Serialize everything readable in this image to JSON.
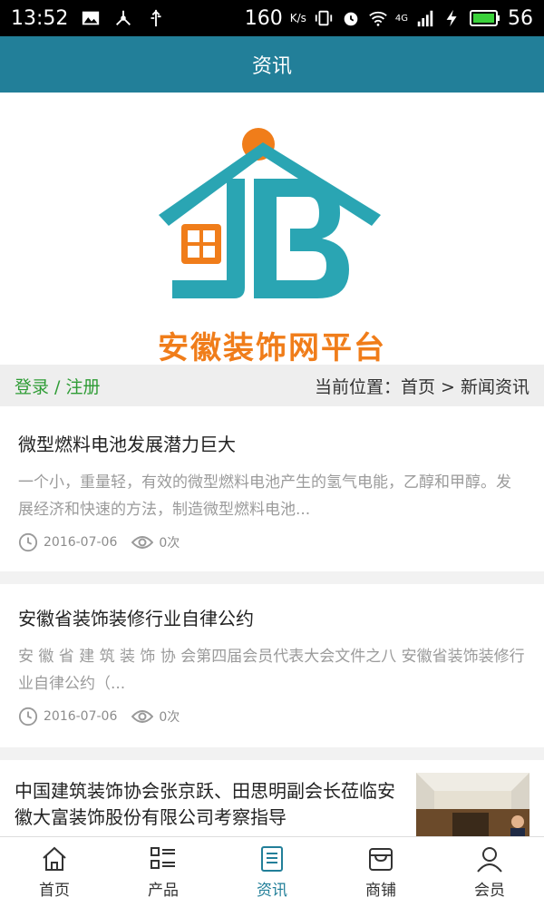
{
  "status": {
    "time": "13:52",
    "speed": "160",
    "speed_unit": "K/s",
    "network": "4G",
    "battery": "56"
  },
  "header": {
    "title": "资讯"
  },
  "logo": {
    "text": "安徽装饰网平台"
  },
  "crumb": {
    "login": "登录 / 注册",
    "location": "当前位置：首页 > 新闻资讯"
  },
  "news": [
    {
      "title": "微型燃料电池发展潜力巨大",
      "summary": "一个小，重量轻，有效的微型燃料电池产生的氢气电能，乙醇和甲醇。发展经济和快速的方法，制造微型燃料电池...",
      "date": "2016-07-06",
      "views": "0次"
    },
    {
      "title": "安徽省装饰装修行业自律公约",
      "summary": "安 徽 省 建 筑 装 饰 协 会第四届会员代表大会文件之八 安徽省装饰装修行业自律公约（...",
      "date": "2016-07-06",
      "views": "0次"
    },
    {
      "title": "中国建筑装饰协会张京跃、田思明副会长莅临安徽大富装饰股份有限公司考察指导"
    }
  ],
  "tabs": [
    {
      "label": "首页",
      "icon": "home-icon"
    },
    {
      "label": "产品",
      "icon": "grid-list-icon"
    },
    {
      "label": "资讯",
      "icon": "news-icon",
      "active": true
    },
    {
      "label": "商铺",
      "icon": "shop-icon"
    },
    {
      "label": "会员",
      "icon": "user-icon"
    }
  ],
  "colors": {
    "accent": "#227f99",
    "login_green": "#2e9c35",
    "logo_orange": "#f07d1a",
    "logo_teal": "#2aa5b3"
  }
}
